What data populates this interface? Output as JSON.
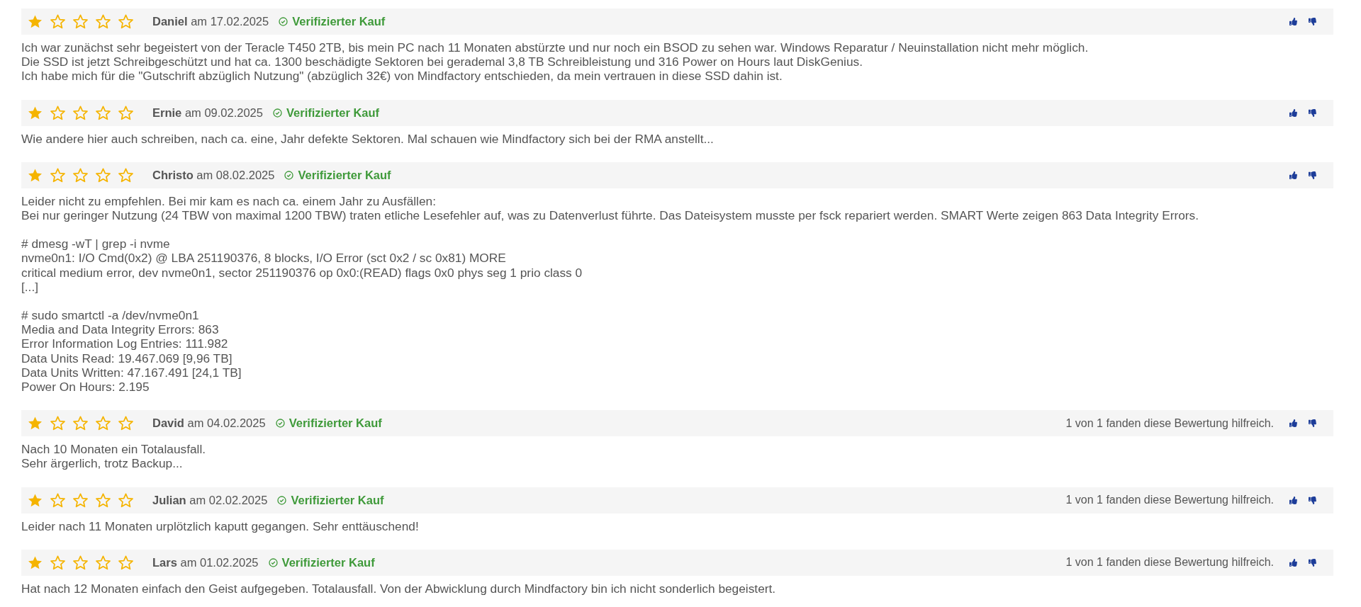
{
  "reviews": [
    {
      "stars": 1,
      "author": "Daniel",
      "date": "am 17.02.2025",
      "verified": true,
      "verified_label": "Verifizierter Kauf",
      "paragraphs": [
        "Ich war zunächst sehr begeistert von der Teracle T450 2TB, bis mein PC nach 11 Monaten abstürzte und nur noch ein BSOD zu sehen war. Windows Reparatur / Neuinstallation nicht mehr möglich.\nDie SSD ist jetzt Schreibgeschützt und hat ca. 1300 beschädigte Sektoren bei gerademal 3,8 TB Schreibleistung und 316 Power on Hours laut DiskGenius.\nIch habe mich für die \"Gutschrift abzüglich Nutzung\" (abzüglich 32€) von Mindfactory entschieden, da mein vertrauen in diese SSD dahin ist."
      ]
    },
    {
      "stars": 1,
      "author": "Ernie",
      "date": "am 09.02.2025",
      "verified": true,
      "verified_label": "Verifizierter Kauf",
      "paragraphs": [
        "Wie andere hier auch schreiben, nach ca. eine, Jahr defekte Sektoren. Mal schauen wie Mindfactory sich bei der RMA anstellt..."
      ]
    },
    {
      "stars": 1,
      "author": "Christo",
      "date": "am 08.02.2025",
      "verified": true,
      "verified_label": "Verifizierter Kauf",
      "paragraphs": [
        "Leider nicht zu empfehlen. Bei mir kam es nach ca. einem Jahr zu Ausfällen:\nBei nur geringer Nutzung (24 TBW von maximal 1200 TBW) traten etliche Lesefehler auf, was zu Datenverlust führte. Das Dateisystem musste per fsck repariert werden. SMART Werte zeigen 863 Data Integrity Errors.",
        "# dmesg -wT | grep -i nvme\nnvme0n1: I/O Cmd(0x2) @ LBA 251190376, 8 blocks, I/O Error (sct 0x2 / sc 0x81) MORE\ncritical medium error, dev nvme0n1, sector 251190376 op 0x0:(READ) flags 0x0 phys seg 1 prio class 0\n[...]",
        "# sudo smartctl -a /dev/nvme0n1\nMedia and Data Integrity Errors: 863\nError Information Log Entries: 111.982\nData Units Read: 19.467.069 [9,96 TB]\nData Units Written: 47.167.491 [24,1 TB]\nPower On Hours: 2.195"
      ]
    },
    {
      "stars": 1,
      "author": "David",
      "date": "am 04.02.2025",
      "verified": true,
      "verified_label": "Verifizierter Kauf",
      "helpful": "1 von 1 fanden diese Bewertung hilfreich.",
      "paragraphs": [
        "Nach 10 Monaten ein Totalausfall.\nSehr ärgerlich, trotz Backup..."
      ]
    },
    {
      "stars": 1,
      "author": "Julian",
      "date": "am 02.02.2025",
      "verified": true,
      "verified_label": "Verifizierter Kauf",
      "helpful": "1 von 1 fanden diese Bewertung hilfreich.",
      "paragraphs": [
        "Leider nach 11 Monaten urplötzlich kaputt gegangen. Sehr enttäuschend!"
      ]
    },
    {
      "stars": 1,
      "author": "Lars",
      "date": "am 01.02.2025",
      "verified": true,
      "verified_label": "Verifizierter Kauf",
      "helpful": "1 von 1 fanden diese Bewertung hilfreich.",
      "paragraphs": [
        "Hat nach 12 Monaten einfach den Geist aufgegeben. Totalausfall. Von der Abwicklung durch Mindfactory bin ich nicht sonderlich begeistert."
      ]
    }
  ]
}
